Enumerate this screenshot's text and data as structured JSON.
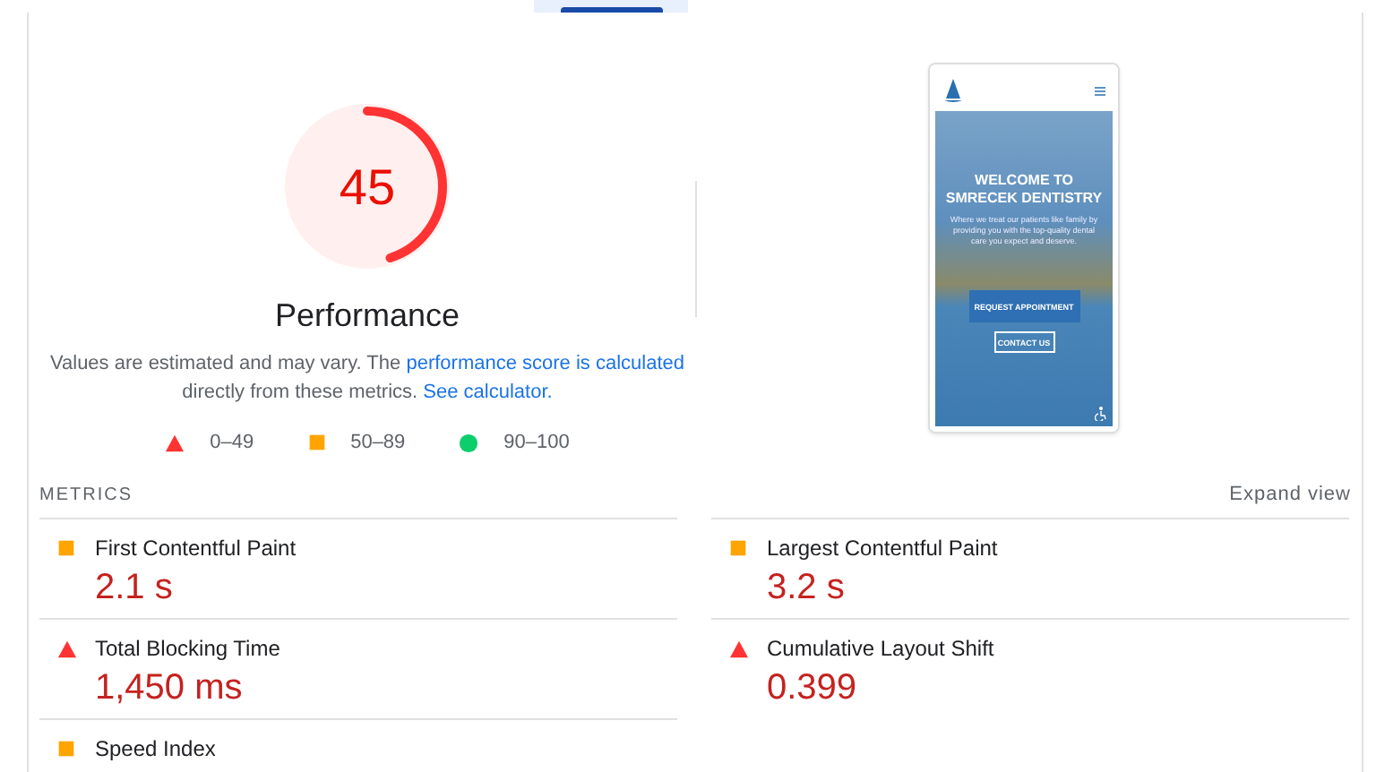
{
  "gauge": {
    "score": "45",
    "level": 0.45,
    "kind": "fail",
    "title": "Performance"
  },
  "description_parts": [
    {
      "kind": "text",
      "text": "Values are estimated and may vary. The "
    },
    {
      "kind": "link",
      "text": "performance score is calculated"
    },
    {
      "kind": "text",
      "text": " directly from these metrics. "
    },
    {
      "kind": "link",
      "text": "See calculator."
    }
  ],
  "legend": [
    {
      "kind": "fail",
      "label": "0–49"
    },
    {
      "kind": "average",
      "label": "50–89"
    },
    {
      "kind": "pass",
      "label": "90–100"
    }
  ],
  "thumbnail": {
    "heading": "WELCOME TO SMRECEK DENTISTRY",
    "subtitle": "Where we treat our patients like family by providing you with the top-quality dental care you expect and deserve.",
    "primary_button": "REQUEST APPOINTMENT",
    "secondary_button": "CONTACT US"
  },
  "metrics": {
    "heading": "METRICS",
    "expand": "Expand view",
    "items": [
      {
        "kind": "average",
        "label": "First Contentful Paint",
        "value": "2.1 s"
      },
      {
        "kind": "average",
        "label": "Largest Contentful Paint",
        "value": "3.2 s"
      },
      {
        "kind": "fail",
        "label": "Total Blocking Time",
        "value": "1,450 ms"
      },
      {
        "kind": "fail",
        "label": "Cumulative Layout Shift",
        "value": "0.399"
      },
      {
        "kind": "average",
        "label": "Speed Index"
      }
    ]
  }
}
